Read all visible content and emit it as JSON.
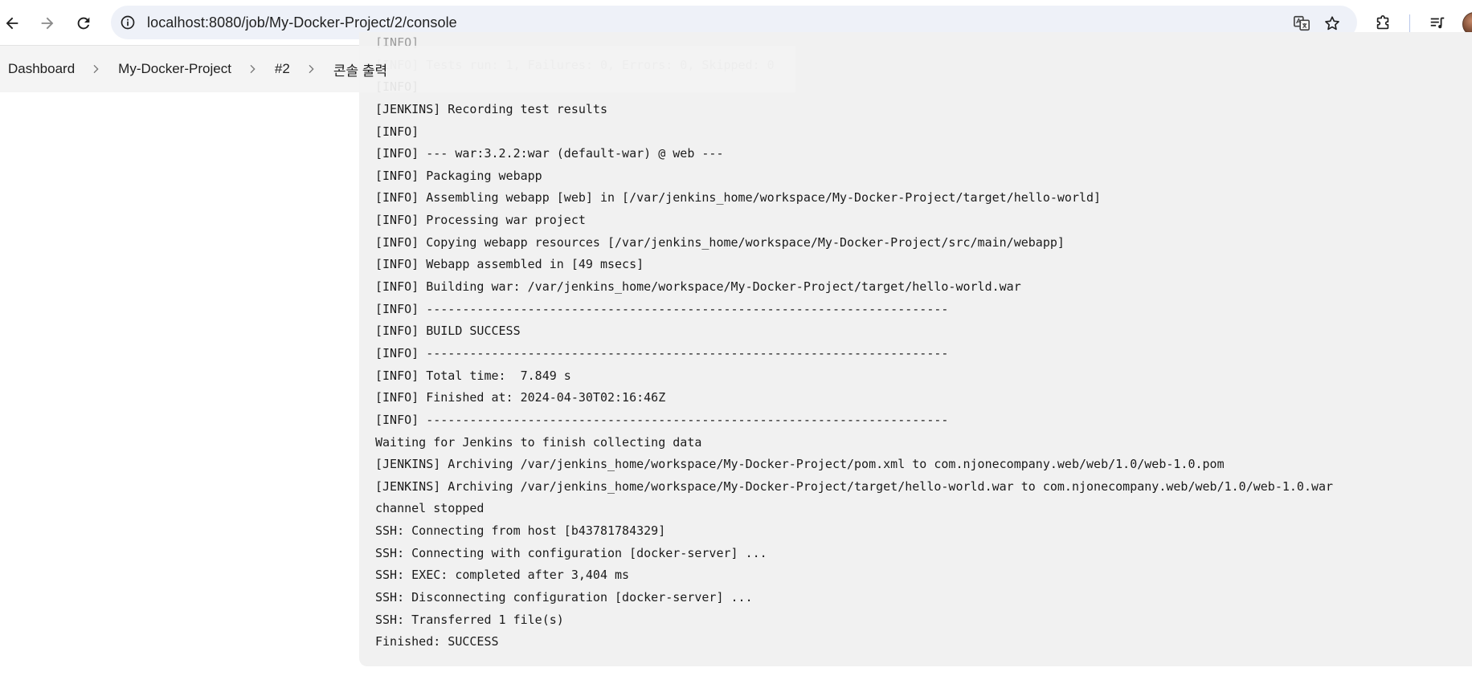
{
  "browser": {
    "url": "localhost:8080/job/My-Docker-Project/2/console",
    "icons": [
      "back-arrow-icon",
      "forward-arrow-icon",
      "reload-icon",
      "site-info-icon",
      "translate-icon",
      "bookmark-star-icon",
      "extensions-puzzle-icon",
      "media-queue-icon",
      "profile-avatar"
    ]
  },
  "breadcrumb": [
    {
      "label": "Dashboard"
    },
    {
      "label": "My-Docker-Project"
    },
    {
      "label": "#2"
    },
    {
      "label": "콘솔 출력"
    }
  ],
  "console": {
    "lines": [
      "[INFO]",
      "[INFO] Tests run: 1, Failures: 0, Errors: 0, Skipped: 0",
      "[INFO]",
      "[JENKINS] Recording test results",
      "[INFO]",
      "[INFO] --- war:3.2.2:war (default-war) @ web ---",
      "[INFO] Packaging webapp",
      "[INFO] Assembling webapp [web] in [/var/jenkins_home/workspace/My-Docker-Project/target/hello-world]",
      "[INFO] Processing war project",
      "[INFO] Copying webapp resources [/var/jenkins_home/workspace/My-Docker-Project/src/main/webapp]",
      "[INFO] Webapp assembled in [49 msecs]",
      "[INFO] Building war: /var/jenkins_home/workspace/My-Docker-Project/target/hello-world.war",
      "[INFO] ------------------------------------------------------------------------",
      "[INFO] BUILD SUCCESS",
      "[INFO] ------------------------------------------------------------------------",
      "[INFO] Total time:  7.849 s",
      "[INFO] Finished at: 2024-04-30T02:16:46Z",
      "[INFO] ------------------------------------------------------------------------",
      "Waiting for Jenkins to finish collecting data",
      "[JENKINS] Archiving /var/jenkins_home/workspace/My-Docker-Project/pom.xml to com.njonecompany.web/web/1.0/web-1.0.pom",
      "[JENKINS] Archiving /var/jenkins_home/workspace/My-Docker-Project/target/hello-world.war to com.njonecompany.web/web/1.0/web-1.0.war",
      "channel stopped",
      "SSH: Connecting from host [b43781784329]",
      "SSH: Connecting with configuration [docker-server] ...",
      "SSH: EXEC: completed after 3,404 ms",
      "SSH: Disconnecting configuration [docker-server] ...",
      "SSH: Transferred 1 file(s)",
      "Finished: SUCCESS"
    ]
  }
}
